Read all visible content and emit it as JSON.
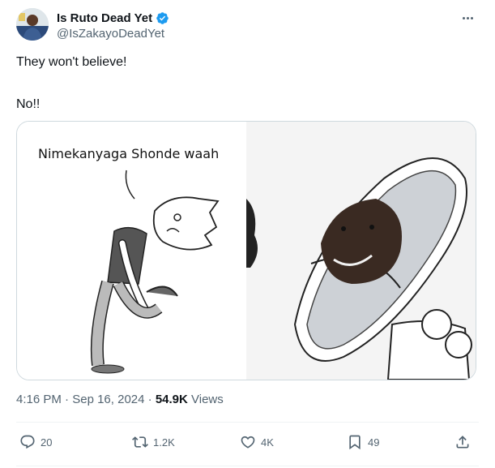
{
  "author": {
    "display_name": "Is Ruto Dead Yet",
    "handle": "@IsZakayoDeadYet",
    "verified": true
  },
  "tweet": {
    "lines": [
      "They won't believe!",
      "No!!"
    ],
    "meme_caption": "Nimekanyaga Shonde waah",
    "time": "4:16 PM",
    "separator": "·",
    "date": "Sep 16, 2024",
    "views_count": "54.9K",
    "views_label": "Views"
  },
  "actions": {
    "replies": "20",
    "reposts": "1.2K",
    "likes": "4K",
    "bookmarks": "49"
  },
  "colors": {
    "verified": "#1d9bf0",
    "secondary_text": "#536471",
    "primary_text": "#0f1419",
    "border": "#cfd9de"
  }
}
